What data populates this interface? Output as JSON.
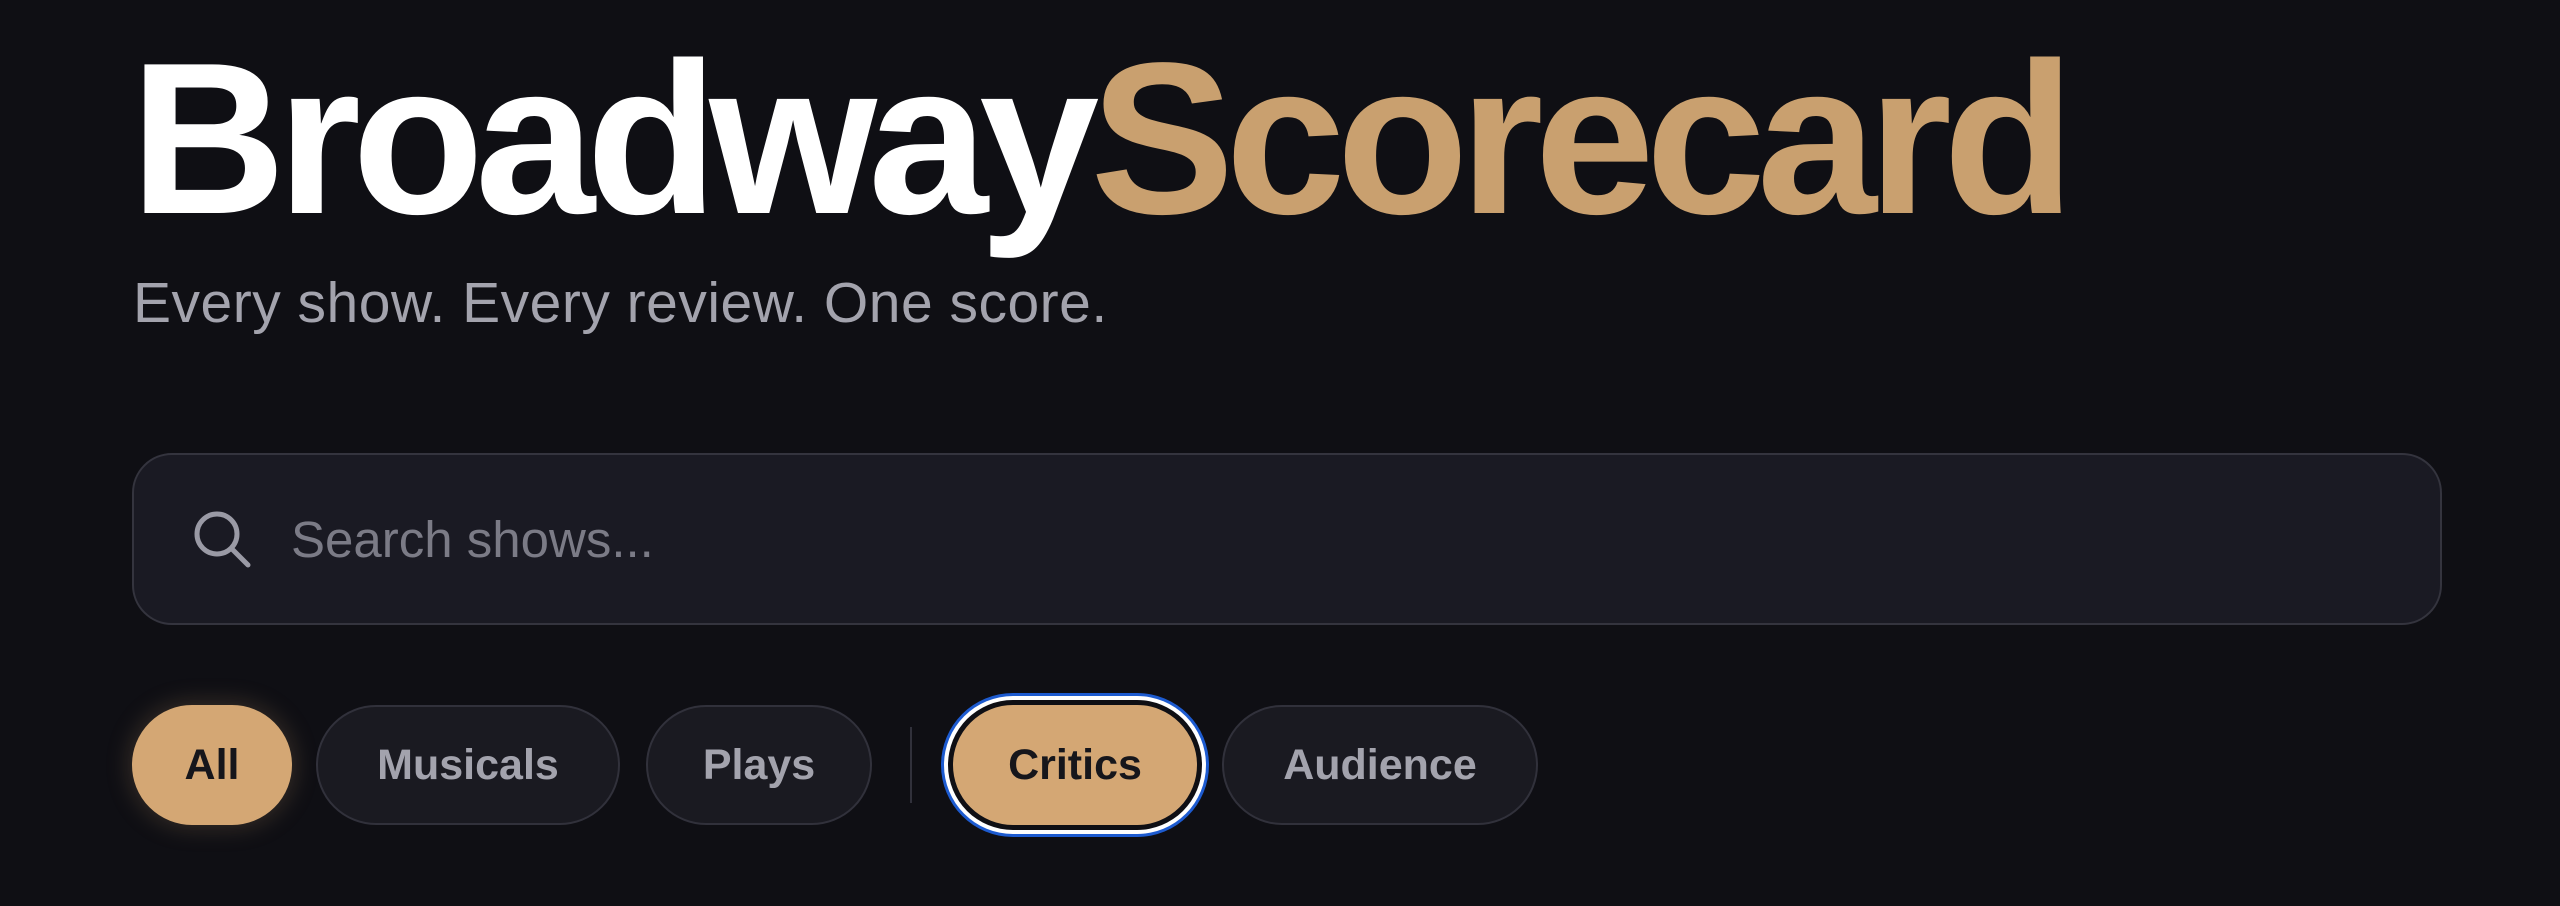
{
  "header": {
    "logo_part_1": "Broadway",
    "logo_part_2": "Scorecard",
    "tagline": "Every show. Every review. One score."
  },
  "search": {
    "placeholder": "Search shows...",
    "value": "",
    "icon": "search-icon"
  },
  "filters": {
    "category": [
      {
        "label": "All",
        "selected": true
      },
      {
        "label": "Musicals",
        "selected": false
      },
      {
        "label": "Plays",
        "selected": false
      }
    ],
    "score_source": [
      {
        "label": "Critics",
        "selected": true,
        "focused": true
      },
      {
        "label": "Audience",
        "selected": false
      }
    ]
  },
  "colors": {
    "background": "#0f0f14",
    "accent": "#d4a774",
    "logo_accent": "#c9a06f",
    "focus_ring": "#1d5bd0"
  }
}
